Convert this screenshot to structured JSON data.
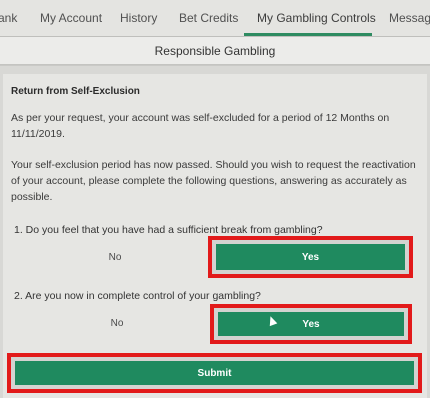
{
  "tabs": [
    {
      "label": "ank"
    },
    {
      "label": "My Account"
    },
    {
      "label": "History"
    },
    {
      "label": "Bet Credits"
    },
    {
      "label": "My Gambling Controls"
    },
    {
      "label": "Messagin"
    }
  ],
  "header": {
    "title": "Responsible Gambling"
  },
  "section": {
    "title": "Return from Self-Exclusion",
    "p1": "As per your request, your account was self-excluded for a period of 12 Months on 11/11/2019.",
    "p2": "Your self-exclusion period has now passed. Should you wish to request the reactivation of your account, please complete the following questions, answering as accurately as possible."
  },
  "questions": [
    {
      "text": "1. Do you feel that you have had a sufficient break from gambling?",
      "no_label": "No",
      "yes_label": "Yes"
    },
    {
      "text": "2. Are you now in complete control of your gambling?",
      "no_label": "No",
      "yes_label": "Yes"
    }
  ],
  "submit_label": "Submit",
  "colors": {
    "accent": "#1f8a5f",
    "highlight": "#e21a1a"
  }
}
